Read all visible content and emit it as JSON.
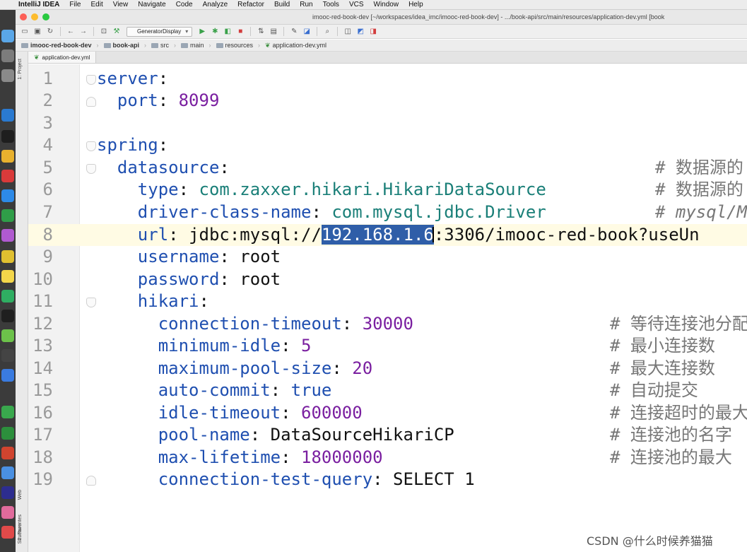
{
  "menubar": {
    "app_name": "IntelliJ IDEA",
    "items": [
      "File",
      "Edit",
      "View",
      "Navigate",
      "Code",
      "Analyze",
      "Refactor",
      "Build",
      "Run",
      "Tools",
      "VCS",
      "Window",
      "Help"
    ]
  },
  "window": {
    "title": "imooc-red-book-dev [~/workspaces/idea_imc/imooc-red-book-dev] - .../book-api/src/main/resources/application-dev.yml [book"
  },
  "toolbar": {
    "run_config": "GeneratorDisplay"
  },
  "breadcrumb": [
    "imooc-red-book-dev",
    "book-api",
    "src",
    "main",
    "resources",
    "application-dev.yml"
  ],
  "tabs": [
    {
      "label": "application-dev.yml",
      "icon": "yaml-file-icon"
    }
  ],
  "left_strip": {
    "project_label": "1: Project",
    "structure_label": "Structure",
    "web_label": "Web",
    "favorites_label": "2: Favorites"
  },
  "editor": {
    "current_line": 8,
    "lines": [
      {
        "num": "1",
        "key": "server",
        "indent": ""
      },
      {
        "num": "2",
        "key": "port",
        "indent": "  ",
        "value": "8099"
      },
      {
        "num": "3"
      },
      {
        "num": "4",
        "key": "spring",
        "indent": ""
      },
      {
        "num": "5",
        "key": "datasource",
        "indent": "  ",
        "comment": "# 数据源的"
      },
      {
        "num": "6",
        "key": "type",
        "indent": "    ",
        "value": "com.zaxxer.hikari.HikariDataSource",
        "comment": "# 数据源的"
      },
      {
        "num": "7",
        "key": "driver-class-name",
        "indent": "    ",
        "value": "com.mysql.jdbc.Driver",
        "comment": "# mysql/M"
      },
      {
        "num": "8",
        "key": "url",
        "indent": "    ",
        "value_before": "jdbc:mysql://",
        "value_selected": "192.168.1.6",
        "value_after": ":3306/imooc-red-book?useUn"
      },
      {
        "num": "9",
        "key": "username",
        "indent": "    ",
        "value": "root"
      },
      {
        "num": "10",
        "key": "password",
        "indent": "    ",
        "value": "root"
      },
      {
        "num": "11",
        "key": "hikari",
        "indent": "    "
      },
      {
        "num": "12",
        "key": "connection-timeout",
        "indent": "      ",
        "value": "30000",
        "comment": "# 等待连接池分配"
      },
      {
        "num": "13",
        "key": "minimum-idle",
        "indent": "      ",
        "value": "5",
        "comment": "# 最小连接数"
      },
      {
        "num": "14",
        "key": "maximum-pool-size",
        "indent": "      ",
        "value": "20",
        "comment": "# 最大连接数"
      },
      {
        "num": "15",
        "key": "auto-commit",
        "indent": "      ",
        "value": "true",
        "comment": "# 自动提交"
      },
      {
        "num": "16",
        "key": "idle-timeout",
        "indent": "      ",
        "value": "600000",
        "comment": "# 连接超时的最大"
      },
      {
        "num": "17",
        "key": "pool-name",
        "indent": "      ",
        "value": "DataSourceHikariCP",
        "comment": "# 连接池的名字"
      },
      {
        "num": "18",
        "key": "max-lifetime",
        "indent": "      ",
        "value": "18000000",
        "comment": "# 连接池的最大"
      },
      {
        "num": "19",
        "key": "connection-test-query",
        "indent": "      ",
        "value": "SELECT 1"
      }
    ]
  },
  "watermark": "CSDN @什么时候养猫猫",
  "colors": {
    "key": "#1f4fb0",
    "number": "#7a1fa0",
    "class_value": "#1a7f78",
    "comment": "#777777",
    "selection": "#2f5ea8",
    "current_line": "#fffbe4"
  }
}
